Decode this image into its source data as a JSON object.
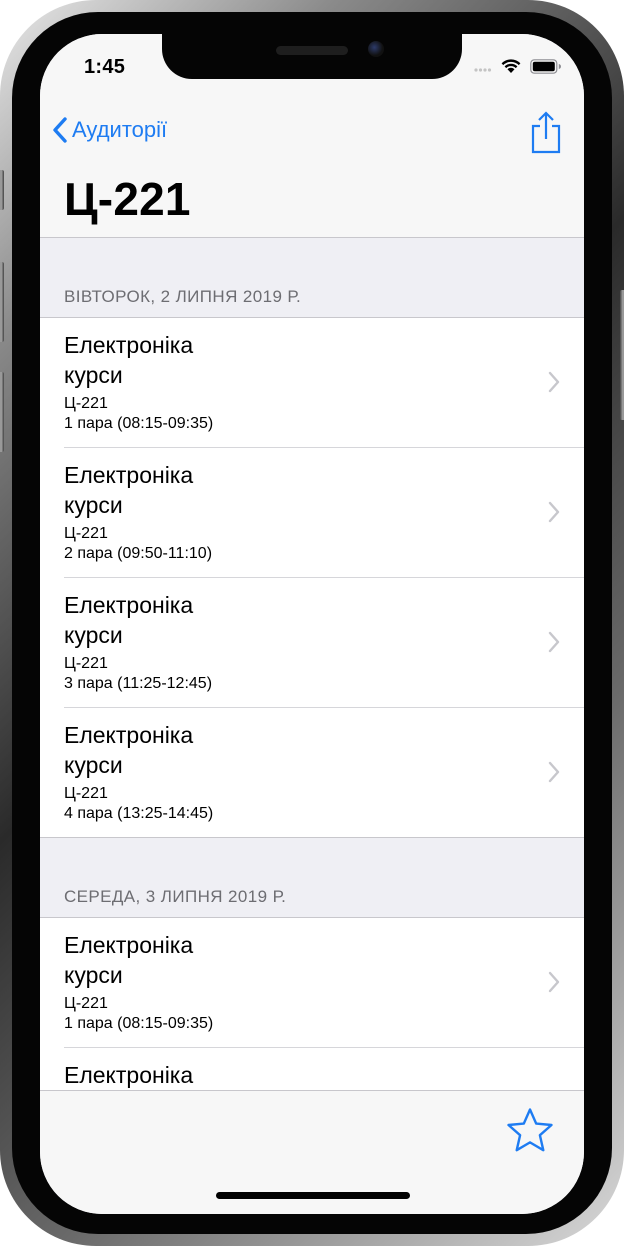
{
  "status_bar": {
    "time": "1:45",
    "icons": [
      "signal-icon",
      "wifi-icon",
      "battery-icon"
    ]
  },
  "nav": {
    "back_label": "Аудиторії",
    "title": "Ц-221",
    "share_icon": "share-icon"
  },
  "sections": [
    {
      "header": "ВІВТОРОК, 2 ЛИПНЯ 2019 Р.",
      "items": [
        {
          "title": "Електроніка\nкурси",
          "room": "Ц-221",
          "time": "1 пара (08:15-09:35)"
        },
        {
          "title": "Електроніка\nкурси",
          "room": "Ц-221",
          "time": "2 пара (09:50-11:10)"
        },
        {
          "title": "Електроніка\nкурси",
          "room": "Ц-221",
          "time": "3 пара (11:25-12:45)"
        },
        {
          "title": "Електроніка\nкурси",
          "room": "Ц-221",
          "time": "4 пара (13:25-14:45)"
        }
      ]
    },
    {
      "header": "СЕРЕДА, 3 ЛИПНЯ 2019 Р.",
      "items": [
        {
          "title": "Електроніка\nкурси",
          "room": "Ц-221",
          "time": "1 пара (08:15-09:35)"
        },
        {
          "title": "Електроніка",
          "room": "",
          "time": ""
        }
      ]
    }
  ],
  "toolbar": {
    "favorite_icon": "star-icon"
  },
  "colors": {
    "accent": "#1e7cf2",
    "background": "#efeff4",
    "section_text": "#6d6d72",
    "chevron": "#c7c7cc"
  }
}
